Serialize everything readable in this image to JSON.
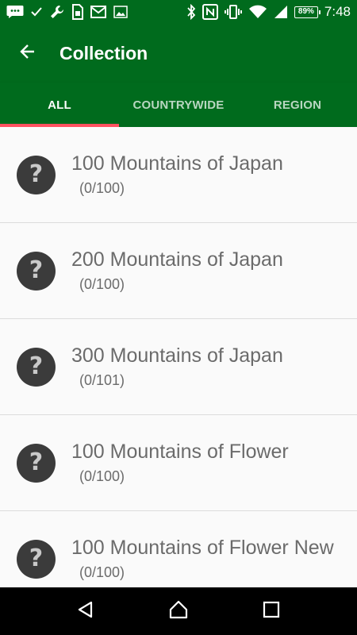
{
  "status_bar": {
    "battery": "89%",
    "time": "7:48",
    "left_icons": [
      "message-icon",
      "check-icon",
      "wrench-icon",
      "sim-icon",
      "gmail-icon",
      "image-icon"
    ],
    "right_icons": [
      "bluetooth-icon",
      "nfc-icon",
      "vibrate-icon",
      "wifi-icon",
      "signal-icon",
      "battery-icon"
    ]
  },
  "app_bar": {
    "title": "Collection",
    "back_icon": "arrow-back-icon"
  },
  "tabs": [
    {
      "label": "ALL",
      "active": true
    },
    {
      "label": "COUNTRYWIDE",
      "active": false
    },
    {
      "label": "REGION",
      "active": false
    }
  ],
  "colors": {
    "primary": "#006b1d",
    "tab_indicator": "#ff5260",
    "badge": "#3b3b3b",
    "text": "#6b6b6b"
  },
  "items": [
    {
      "title": "100 Mountains of Japan",
      "count": "(0/100)",
      "icon": "question-badge-icon"
    },
    {
      "title": "200 Mountains of Japan",
      "count": "(0/100)",
      "icon": "question-badge-icon"
    },
    {
      "title": "300 Mountains of Japan",
      "count": "(0/101)",
      "icon": "question-badge-icon"
    },
    {
      "title": "100 Mountains of Flower",
      "count": "(0/100)",
      "icon": "question-badge-icon"
    },
    {
      "title": "100 Mountains of Flower New",
      "count": "(0/100)",
      "icon": "question-badge-icon"
    }
  ],
  "badge_glyph": "?",
  "nav_bar": [
    "back-triangle-icon",
    "home-icon",
    "recents-icon"
  ]
}
